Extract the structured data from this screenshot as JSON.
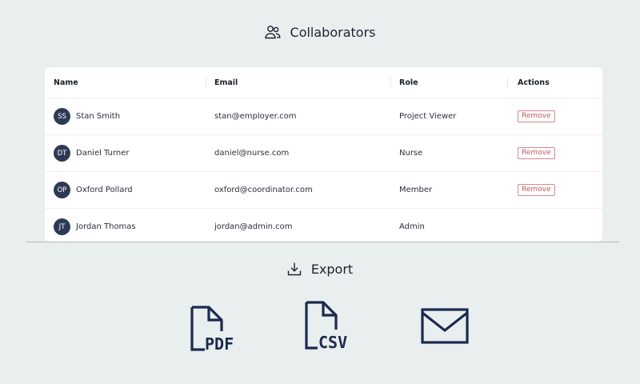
{
  "collaborators": {
    "title": "Collaborators",
    "columns": {
      "name": "Name",
      "email": "Email",
      "role": "Role",
      "actions": "Actions"
    },
    "rows": [
      {
        "initials": "SS",
        "name": "Stan Smith",
        "email": "stan@employer.com",
        "role": "Project Viewer",
        "action": "Remove"
      },
      {
        "initials": "DT",
        "name": "Daniel Turner",
        "email": "daniel@nurse.com",
        "role": "Nurse",
        "action": "Remove"
      },
      {
        "initials": "OP",
        "name": "Oxford Pollard",
        "email": "oxford@coordinator.com",
        "role": "Member",
        "action": "Remove"
      },
      {
        "initials": "JT",
        "name": "Jordan Thomas",
        "email": "jordan@admin.com",
        "role": "Admin",
        "action": ""
      }
    ]
  },
  "export": {
    "title": "Export",
    "options": [
      {
        "label": "PDF",
        "icon": "pdf-file-icon"
      },
      {
        "label": "CSV",
        "icon": "csv-file-icon"
      },
      {
        "icon": "mail-icon"
      }
    ]
  },
  "colors": {
    "background": "#e9eeee",
    "avatar": "#2e3a55",
    "remove": "#c2585f",
    "icon": "#1b2a4e"
  }
}
